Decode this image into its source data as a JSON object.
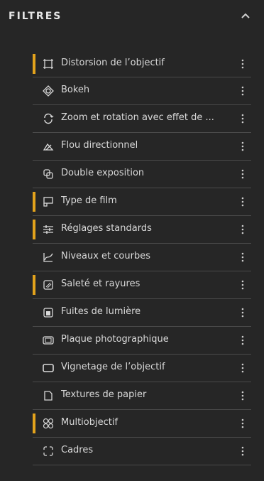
{
  "panel": {
    "title": "FILTRES",
    "collapse_icon": "chevron-up-icon",
    "accent_color": "#e3a31c"
  },
  "filters": [
    {
      "label": "Distorsion de l’objectif",
      "icon": "frame-corners-icon",
      "active": true
    },
    {
      "label": "Bokeh",
      "icon": "bokeh-icon",
      "active": false
    },
    {
      "label": "Zoom et rotation avec effet de ...",
      "icon": "rotate-arrows-icon",
      "active": false
    },
    {
      "label": "Flou directionnel",
      "icon": "motion-blur-icon",
      "active": false
    },
    {
      "label": "Double exposition",
      "icon": "double-exposure-icon",
      "active": false
    },
    {
      "label": "Type de film",
      "icon": "film-type-icon",
      "active": true
    },
    {
      "label": "Réglages standards",
      "icon": "adjustments-icon",
      "active": true
    },
    {
      "label": "Niveaux et courbes",
      "icon": "levels-curves-icon",
      "active": false
    },
    {
      "label": "Saleté et rayures",
      "icon": "dirt-scratches-icon",
      "active": true
    },
    {
      "label": "Fuites de lumière",
      "icon": "light-leak-icon",
      "active": false
    },
    {
      "label": "Plaque photographique",
      "icon": "photo-plate-icon",
      "active": false
    },
    {
      "label": "Vignetage de l’objectif",
      "icon": "vignette-icon",
      "active": false
    },
    {
      "label": "Textures de papier",
      "icon": "paper-texture-icon",
      "active": false
    },
    {
      "label": "Multiobjectif",
      "icon": "multilens-icon",
      "active": true
    },
    {
      "label": "Cadres",
      "icon": "frames-icon",
      "active": false
    }
  ]
}
